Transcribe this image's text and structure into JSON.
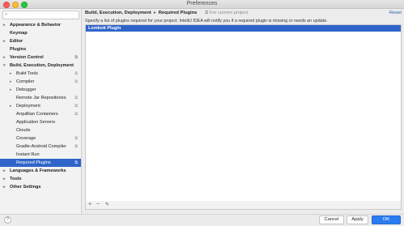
{
  "window": {
    "title": "Preferences"
  },
  "sidebar": {
    "search_placeholder": "",
    "items": [
      {
        "label": "Appearance & Behavior",
        "bold": true,
        "arrow": "▸",
        "level": 0
      },
      {
        "label": "Keymap",
        "bold": true,
        "arrow": "",
        "level": 0
      },
      {
        "label": "Editor",
        "bold": true,
        "arrow": "▸",
        "level": 0
      },
      {
        "label": "Plugins",
        "bold": true,
        "arrow": "",
        "level": 0
      },
      {
        "label": "Version Control",
        "bold": true,
        "arrow": "▸",
        "level": 0,
        "cfg": true
      },
      {
        "label": "Build, Execution, Deployment",
        "bold": true,
        "arrow": "▾",
        "level": 0
      },
      {
        "label": "Build Tools",
        "bold": false,
        "arrow": "▸",
        "level": 1,
        "cfg": true
      },
      {
        "label": "Compiler",
        "bold": false,
        "arrow": "▸",
        "level": 1,
        "cfg": true
      },
      {
        "label": "Debugger",
        "bold": false,
        "arrow": "▸",
        "level": 1
      },
      {
        "label": "Remote Jar Repositories",
        "bold": false,
        "arrow": "",
        "level": 1,
        "cfg": true
      },
      {
        "label": "Deployment",
        "bold": false,
        "arrow": "▸",
        "level": 1,
        "cfg": true
      },
      {
        "label": "Arquillian Containers",
        "bold": false,
        "arrow": "",
        "level": 1,
        "cfg": true
      },
      {
        "label": "Application Servers",
        "bold": false,
        "arrow": "",
        "level": 1
      },
      {
        "label": "Clouds",
        "bold": false,
        "arrow": "",
        "level": 1
      },
      {
        "label": "Coverage",
        "bold": false,
        "arrow": "",
        "level": 1,
        "cfg": true
      },
      {
        "label": "Gradle-Android Compiler",
        "bold": false,
        "arrow": "",
        "level": 1,
        "cfg": true
      },
      {
        "label": "Instant Run",
        "bold": false,
        "arrow": "",
        "level": 1
      },
      {
        "label": "Required Plugins",
        "bold": false,
        "arrow": "",
        "level": 1,
        "cfg": true,
        "selected": true
      },
      {
        "label": "Languages & Frameworks",
        "bold": true,
        "arrow": "▸",
        "level": 0
      },
      {
        "label": "Tools",
        "bold": true,
        "arrow": "▸",
        "level": 0
      },
      {
        "label": "Other Settings",
        "bold": true,
        "arrow": "▸",
        "level": 0
      }
    ]
  },
  "header": {
    "breadcrumb_parent": "Build, Execution, Deployment",
    "breadcrumb_sep": "▸",
    "breadcrumb_current": "Required Plugins",
    "scope_label": "For current project",
    "reset_label": "Reset"
  },
  "main": {
    "description": "Specify a list of plugins required for your project. IntelliJ IDEA will notify you if a required plugin is missing or needs an update.",
    "plugins": [
      {
        "name": "Lombok Plugin",
        "selected": true
      }
    ],
    "toolbar": {
      "add": "+",
      "remove": "−",
      "edit": "✎"
    }
  },
  "footer": {
    "help": "?",
    "cancel_label": "Cancel",
    "apply_label": "Apply",
    "ok_label": "OK"
  },
  "colors": {
    "selection": "#2f65ca",
    "accent": "#2b7bf0",
    "link": "#2a5db0"
  }
}
